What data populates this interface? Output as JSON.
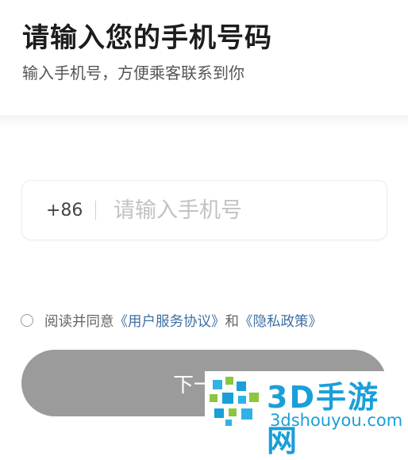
{
  "header": {
    "title": "请输入您的手机号码",
    "subtitle": "输入手机号，方便乘客联系到你"
  },
  "phone": {
    "country_code": "+86",
    "placeholder": "请输入手机号",
    "value": ""
  },
  "agreement": {
    "checked": false,
    "prefix": "阅读并同意",
    "user_agreement": "《用户服务协议》",
    "connector": "和",
    "privacy_policy": "《隐私政策》"
  },
  "next_button": {
    "label": "下一步"
  },
  "watermark": {
    "brand": "3D手游网",
    "domain": "3dshouyou.com"
  },
  "colors": {
    "link": "#3f6fa4",
    "button_disabled": "#9b9b9b",
    "watermark": "#1a9fd8"
  }
}
